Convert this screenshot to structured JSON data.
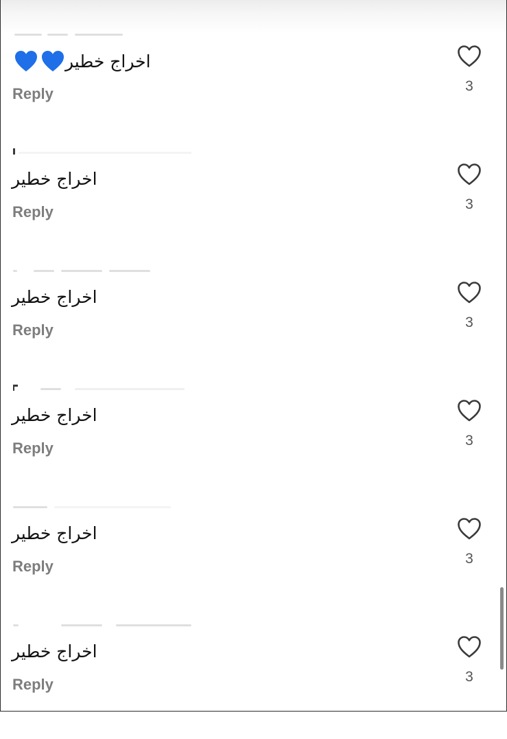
{
  "comments": [
    {
      "text": "اخراج خطير",
      "hearts": 2,
      "reply_label": "Reply",
      "like_count": "3"
    },
    {
      "text": "اخراج خطير",
      "hearts": 0,
      "reply_label": "Reply",
      "like_count": "3"
    },
    {
      "text": "اخراج خطير",
      "hearts": 0,
      "reply_label": "Reply",
      "like_count": "3"
    },
    {
      "text": "اخراج  خطير",
      "hearts": 0,
      "reply_label": "Reply",
      "like_count": "3"
    },
    {
      "text": "اخراج خطير",
      "hearts": 0,
      "reply_label": "Reply",
      "like_count": "3"
    },
    {
      "text": "اخراج خطير",
      "hearts": 0,
      "reply_label": "Reply",
      "like_count": "3"
    }
  ],
  "icons": {
    "like": "heart-outline-icon",
    "emoji": "blue-heart-emoji-icon"
  },
  "colors": {
    "emoji_heart": "#1e6fe8",
    "reply": "#7d7d7d",
    "text": "#111111"
  }
}
